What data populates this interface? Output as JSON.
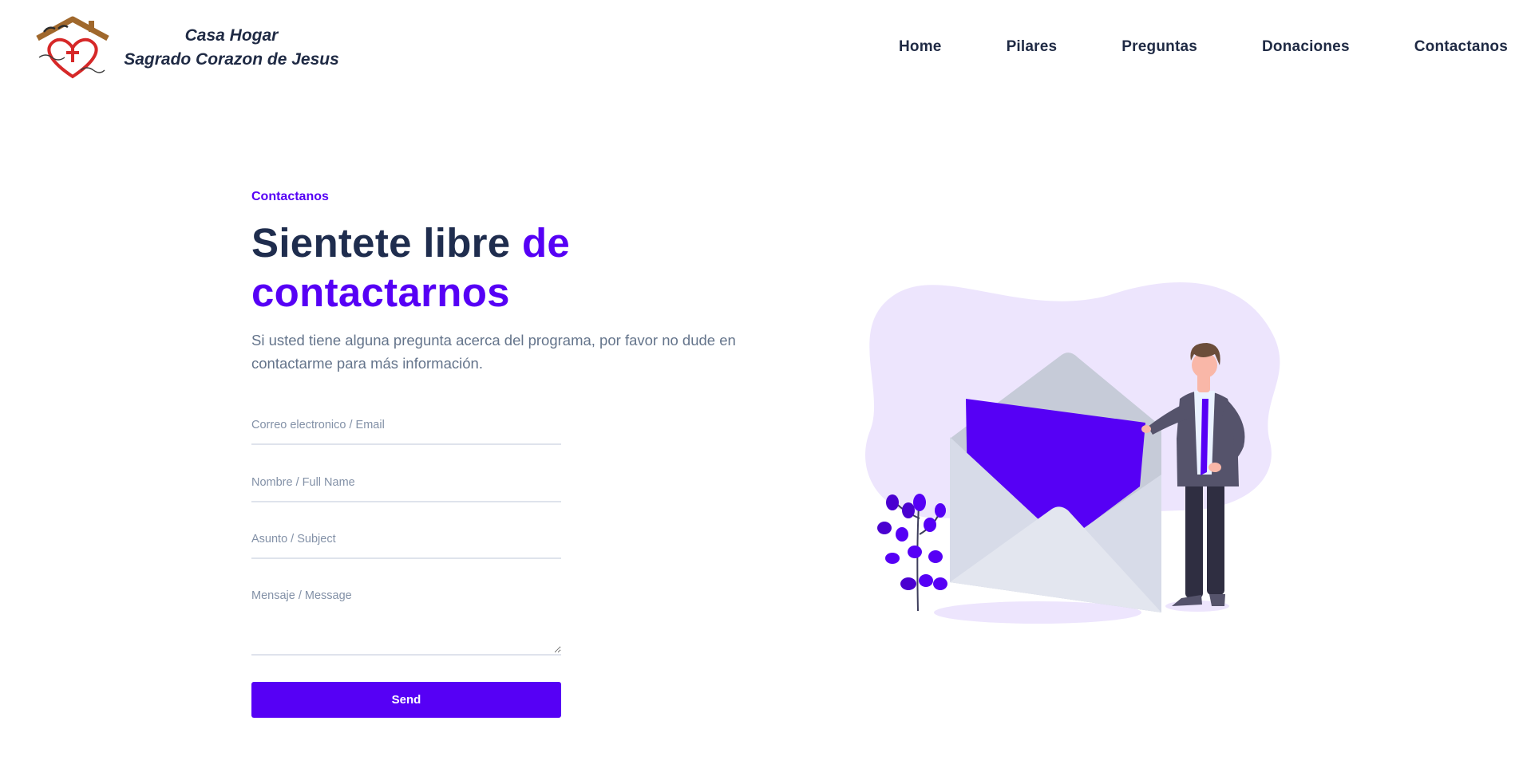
{
  "brand": {
    "logo_icon": "casa-hogar-heart-house-logo",
    "line1": "Casa Hogar",
    "line2": "Sagrado Corazon de Jesus"
  },
  "nav": {
    "items": [
      {
        "label": "Home"
      },
      {
        "label": "Pilares"
      },
      {
        "label": "Preguntas"
      },
      {
        "label": "Donaciones"
      },
      {
        "label": "Contactanos"
      }
    ]
  },
  "contact": {
    "eyebrow": "Contactanos",
    "headline_part1": "Sientete libre ",
    "headline_accent": "de contactarnos",
    "lead": "Si usted tiene alguna pregunta acerca del programa, por favor no dude en contactarme para más información.",
    "form": {
      "email_placeholder": "Correo electronico / Email",
      "name_placeholder": "Nombre / Full Name",
      "subject_placeholder": "Asunto / Subject",
      "message_placeholder": "Mensaje / Message",
      "send_label": "Send"
    }
  },
  "colors": {
    "accent": "#5600f5",
    "heading": "#1f2d4e",
    "muted": "#64748b",
    "blob": "#ede5fd"
  },
  "illustration": {
    "icon": "man-opening-envelope-illustration"
  }
}
